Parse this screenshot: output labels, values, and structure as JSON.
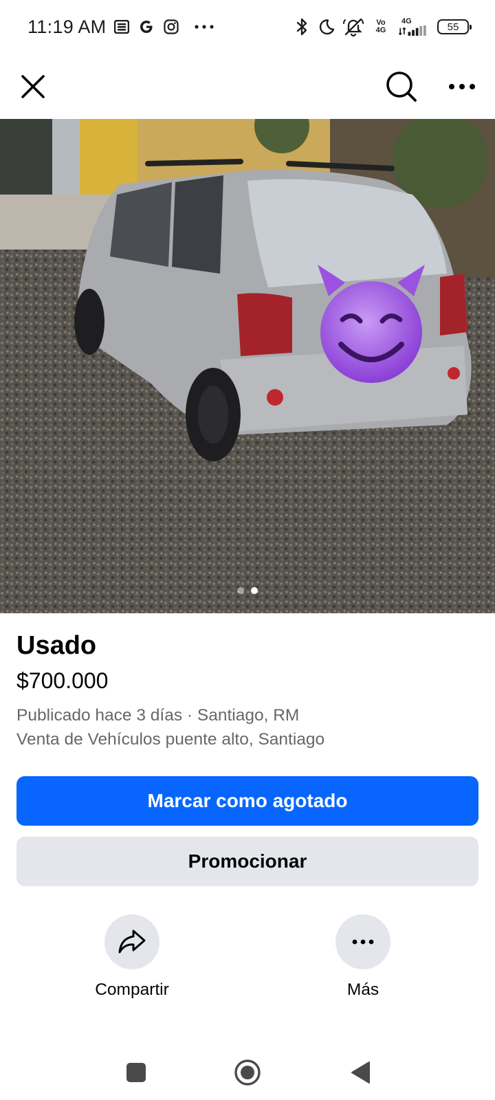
{
  "status_bar": {
    "time": "11:19 AM",
    "network_label": "Vo 4G",
    "network_label_top": "4G",
    "battery": "55",
    "icons": [
      "news-icon",
      "google-icon",
      "instagram-icon",
      "more-notifications-icon",
      "bluetooth-icon",
      "moon-icon",
      "mute-icon",
      "volte-icon",
      "signal-icon",
      "battery-icon"
    ]
  },
  "top_bar": {
    "icons": [
      "close-icon",
      "search-icon",
      "more-options-icon"
    ]
  },
  "listing": {
    "photo_icon": "car-photo",
    "carousel": {
      "count": 2,
      "active_index": 1
    },
    "title": "Usado",
    "price": "$700.000",
    "meta_line": "Publicado hace 3 días · Santiago, RM",
    "group_line": "Venta de Vehículos puente alto, Santiago"
  },
  "buttons": {
    "primary": "Marcar como agotado",
    "secondary": "Promocionar"
  },
  "actions": [
    {
      "label": "Compartir",
      "icon": "share-icon"
    },
    {
      "label": "Más",
      "icon": "more-icon"
    }
  ],
  "nav_bar": {
    "icons": [
      "recents-icon",
      "home-icon",
      "back-icon"
    ]
  },
  "colors": {
    "primary_button": "#0866ff",
    "secondary_button": "#e4e6eb",
    "meta_text": "#65676b",
    "text": "#050505"
  }
}
